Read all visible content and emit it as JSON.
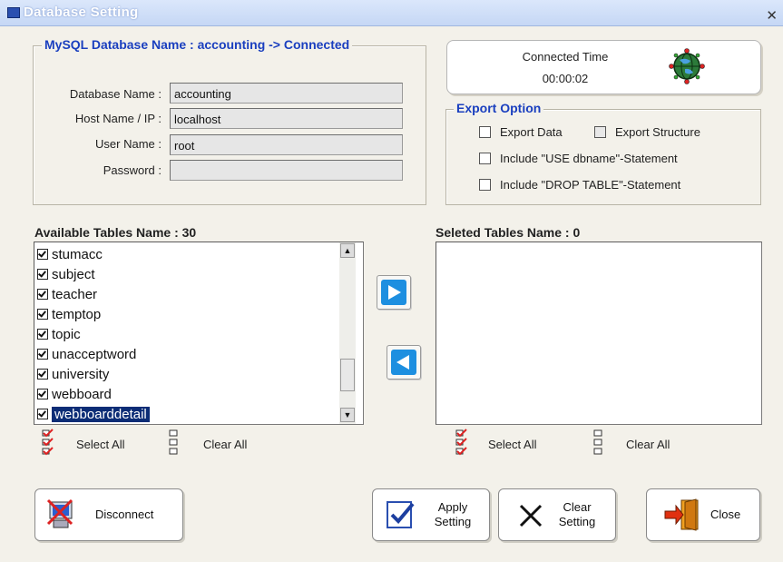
{
  "window": {
    "title": "Database Setting",
    "close_glyph": "✕"
  },
  "db_group": {
    "legend": "MySQL Database Name : accounting -> Connected",
    "fields": [
      {
        "label": "Database Name :",
        "value": "accounting"
      },
      {
        "label": "Host Name / IP :",
        "value": "localhost"
      },
      {
        "label": "User Name :",
        "value": "root"
      },
      {
        "label": "Password :",
        "value": ""
      }
    ]
  },
  "connection": {
    "title": "Connected Time",
    "time": "00:00:02",
    "icon": "globe-network-icon"
  },
  "export": {
    "legend": "Export Option",
    "options": [
      {
        "label": "Export Data",
        "checked": false
      },
      {
        "label": "Export Structure",
        "checked": false
      },
      {
        "label": "Include \"USE dbname\"-Statement",
        "checked": false
      },
      {
        "label": "Include \"DROP TABLE\"-Statement",
        "checked": false
      }
    ]
  },
  "available": {
    "title": "Available Tables Name : 30",
    "items": [
      {
        "name": "stumacc",
        "checked": true
      },
      {
        "name": "subject",
        "checked": true
      },
      {
        "name": "teacher",
        "checked": true
      },
      {
        "name": "temptop",
        "checked": true
      },
      {
        "name": "topic",
        "checked": true
      },
      {
        "name": "unacceptword",
        "checked": true
      },
      {
        "name": "university",
        "checked": true
      },
      {
        "name": "webboard",
        "checked": true
      },
      {
        "name": "webboarddetail",
        "checked": true,
        "selected": true
      }
    ],
    "select_all": "Select All",
    "clear_all": "Clear All"
  },
  "selected": {
    "title": "Seleted Tables Name : 0",
    "items": [],
    "select_all": "Select All",
    "clear_all": "Clear All"
  },
  "buttons": {
    "disconnect": "Disconnect",
    "apply_1": "Apply",
    "apply_2": "Setting",
    "clear_1": "Clear",
    "clear_2": "Setting",
    "close": "Close"
  },
  "colors": {
    "accent_blue": "#1a3fbf",
    "selection": "#0c2d76",
    "window_bg": "#f3f1ea"
  }
}
